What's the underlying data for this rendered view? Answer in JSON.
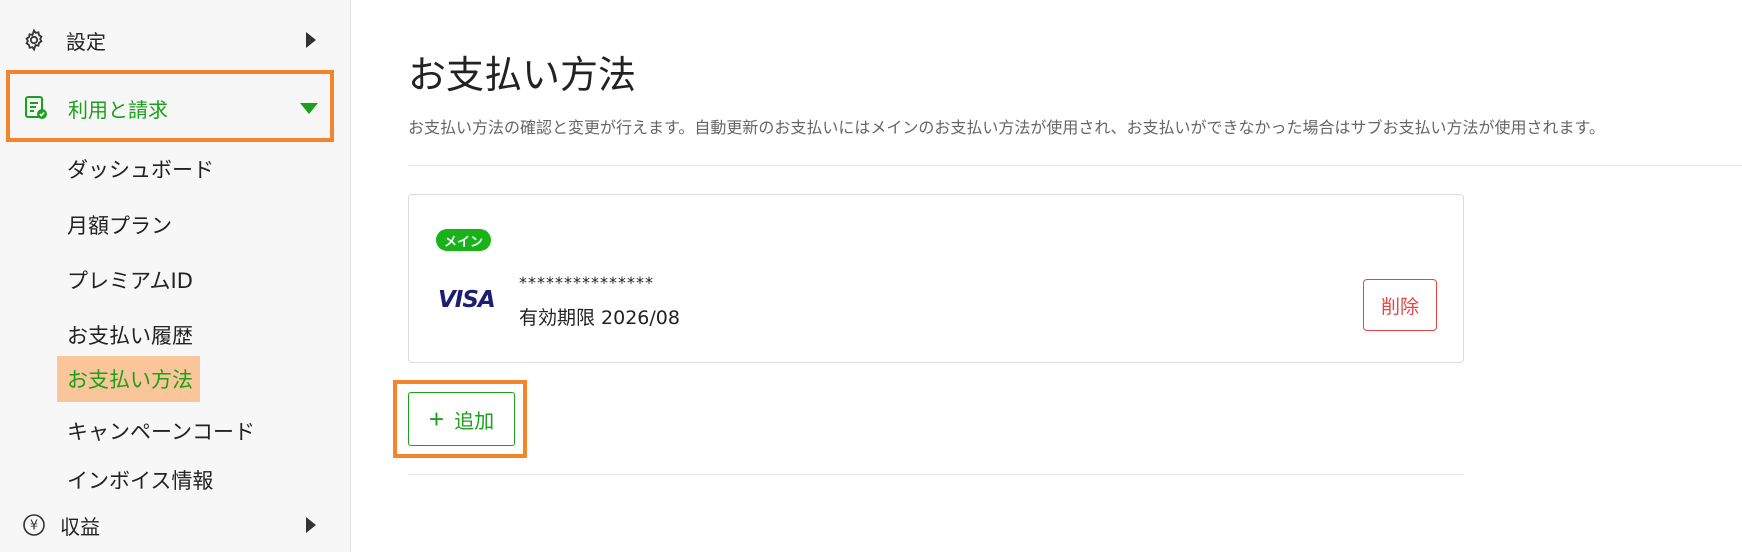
{
  "sidebar": {
    "settings_label": "設定",
    "billing_label": "利用と請求",
    "sub_items": [
      "ダッシュボード",
      "月額プラン",
      "プレミアムID",
      "お支払い履歴",
      "お支払い方法",
      "キャンペーンコード",
      "インボイス情報"
    ],
    "active_item": "お支払い方法",
    "revenue_label": "収益",
    "revenue_symbol": "¥"
  },
  "main": {
    "title": "お支払い方法",
    "description": "お支払い方法の確認と変更が行えます。自動更新のお支払いにはメインのお支払い方法が使用され、お支払いができなかった場合はサブお支払い方法が使用されます。"
  },
  "card": {
    "badge": "メイン",
    "brand": "VISA",
    "masked_number": "***************",
    "expiry": "有効期限 2026/08",
    "delete_label": "削除"
  },
  "add_button": {
    "label": "追加",
    "icon": "+"
  },
  "colors": {
    "accent": "#1aa01a",
    "highlight": "#f5852b",
    "danger": "#e64545",
    "active_bg": "#fbc59a"
  }
}
